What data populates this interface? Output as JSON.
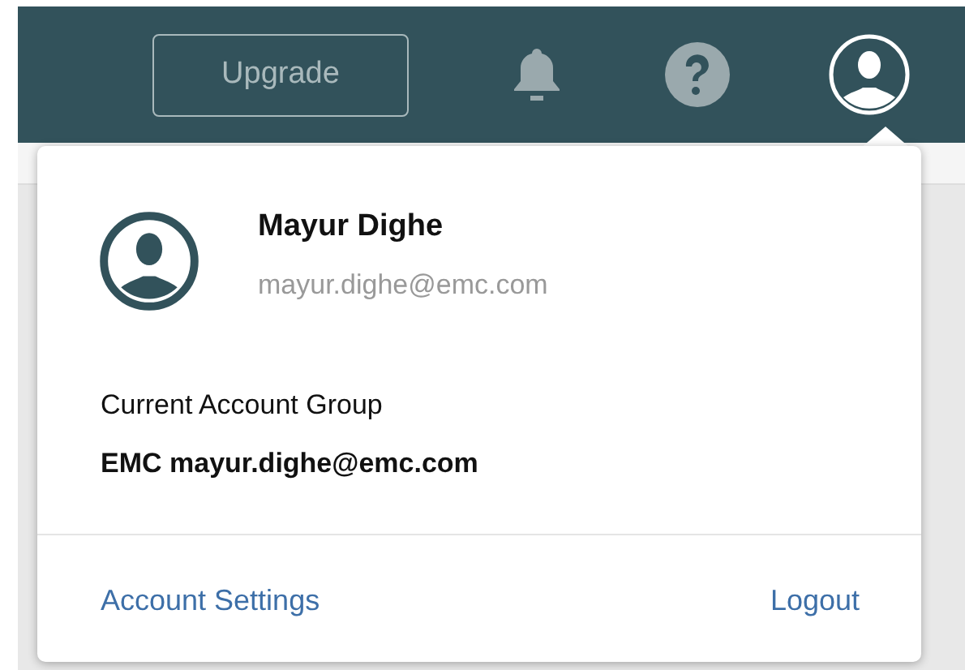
{
  "top_bar": {
    "upgrade_button": "Upgrade"
  },
  "account_menu": {
    "name": "Mayur Dighe",
    "email": "mayur.dighe@emc.com",
    "group_label": "Current Account Group",
    "group_value": "EMC mayur.dighe@emc.com",
    "links": [
      {
        "label": "Account Settings"
      },
      {
        "label": "Logout"
      }
    ]
  }
}
